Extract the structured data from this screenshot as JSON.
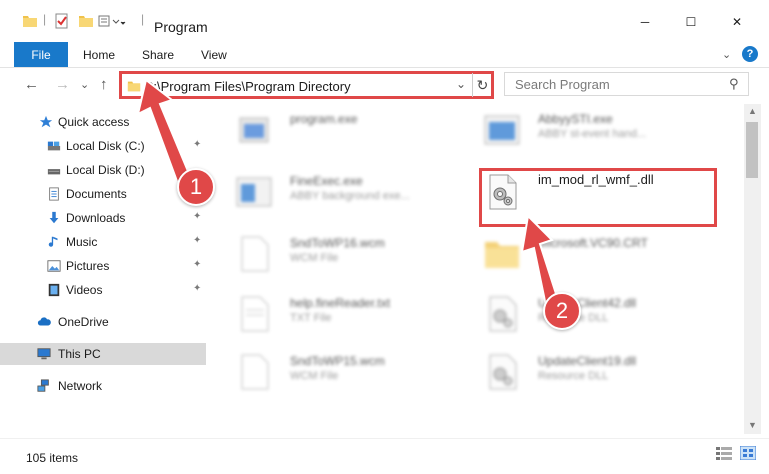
{
  "window": {
    "title": "Program",
    "minimize": "─",
    "maximize": "☐",
    "close": "✕"
  },
  "ribbon": {
    "file": "File",
    "tabs": [
      "Home",
      "Share",
      "View"
    ],
    "expand": "⌄",
    "help": "?"
  },
  "address": {
    "path": "C:\\Program Files\\Program Directory",
    "search_placeholder": "Search Program",
    "back": "←",
    "forward": "→",
    "recent": "⌄",
    "up": "↑",
    "dropdown": "⌄",
    "refresh": "↻",
    "search_icon": "⚲"
  },
  "nav": {
    "quick_access": "Quick access",
    "items": [
      {
        "label": "Local Disk (C:)",
        "icon": "drive-icon",
        "pinned": true
      },
      {
        "label": "Local Disk (D:)",
        "icon": "drive-icon",
        "pinned": false
      },
      {
        "label": "Documents",
        "icon": "documents-icon",
        "pinned": true
      },
      {
        "label": "Downloads",
        "icon": "downloads-icon",
        "pinned": true
      },
      {
        "label": "Music",
        "icon": "music-icon",
        "pinned": true
      },
      {
        "label": "Pictures",
        "icon": "pictures-icon",
        "pinned": true
      },
      {
        "label": "Videos",
        "icon": "videos-icon",
        "pinned": true
      }
    ],
    "onedrive": "OneDrive",
    "this_pc": "This PC",
    "network": "Network",
    "pin_glyph": "📌"
  },
  "files": [
    {
      "name": "program.exe",
      "type": ""
    },
    {
      "name": "AbbyySTI.exe",
      "type": "ABBY st-event hand..."
    },
    {
      "name": "FineExec.exe",
      "type": "ABBY background exe..."
    },
    {
      "name": "im_mod_rl_wmf_.dll",
      "type": ""
    },
    {
      "name": "SndToWP16.wcm",
      "type": "WCM File"
    },
    {
      "name": "Microsoft.VC90.CRT",
      "type": ""
    },
    {
      "name": "help.fineReader.txt",
      "type": "TXT File"
    },
    {
      "name": "UpdateClient42.dll",
      "type": "Resource DLL"
    },
    {
      "name": "SndToWP15.wcm",
      "type": "WCM File"
    },
    {
      "name": "UpdateClient19.dll",
      "type": "Resource DLL"
    }
  ],
  "status": {
    "count": "105 items"
  },
  "annotations": {
    "step1": "1",
    "step2": "2"
  },
  "colors": {
    "accent": "#1979ca",
    "annotation": "#e04848"
  }
}
